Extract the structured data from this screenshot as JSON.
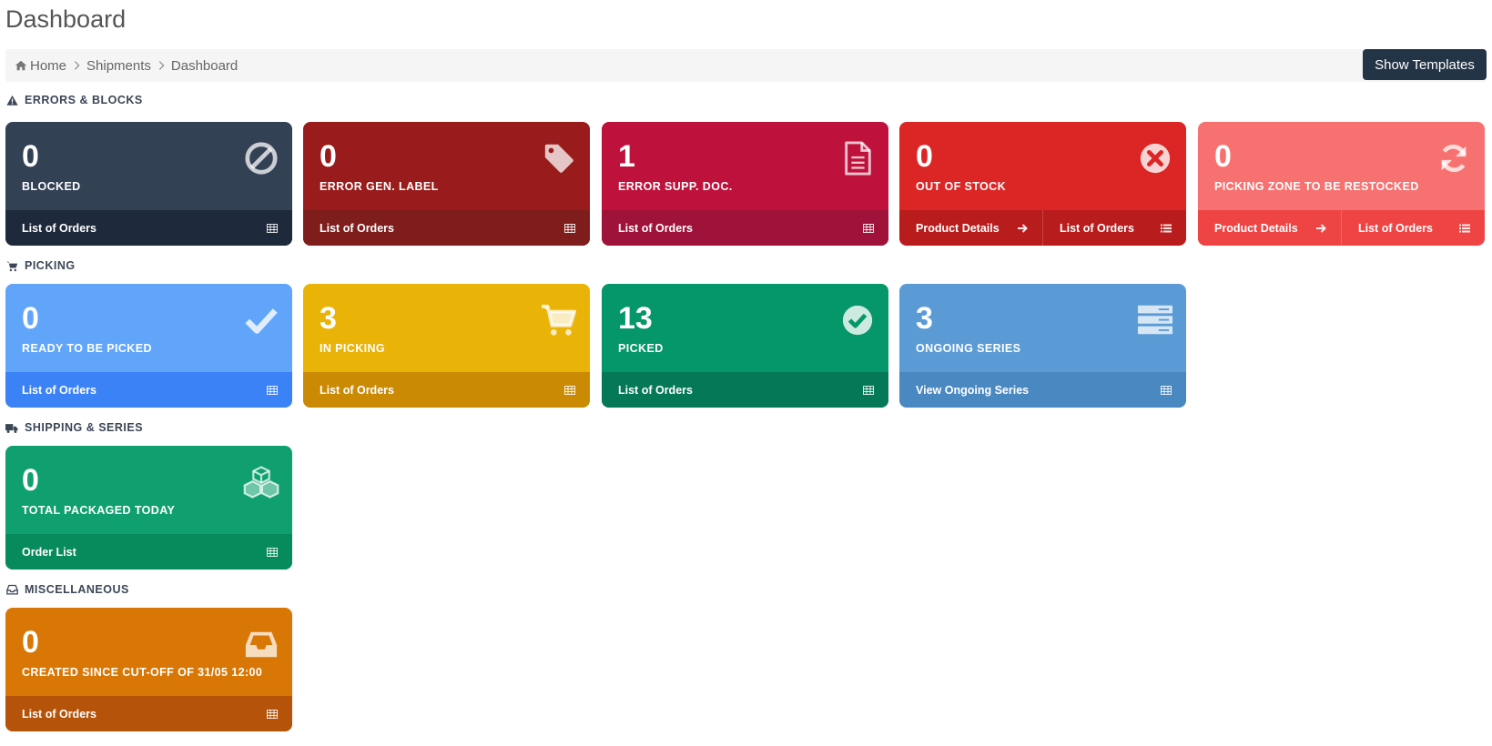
{
  "page": {
    "title": "Dashboard"
  },
  "breadcrumb": {
    "items": [
      "Home",
      "Shipments",
      "Dashboard"
    ]
  },
  "toolbar": {
    "show_templates_label": "Show Templates"
  },
  "sections": {
    "errors": {
      "title": "ERRORS & BLOCKS",
      "icon": "warning-icon"
    },
    "picking": {
      "title": "PICKING",
      "icon": "cart-icon"
    },
    "shipping": {
      "title": "SHIPPING & SERIES",
      "icon": "truck-icon"
    },
    "misc": {
      "title": "MISCELLANEOUS",
      "icon": "inbox-icon"
    }
  },
  "cards": {
    "blocked": {
      "count": "0",
      "label": "BLOCKED",
      "icon": "ban-icon",
      "bg": "#334155",
      "footer_bg": "#1e293b",
      "links": [
        "List of Orders"
      ]
    },
    "error_gen_label": {
      "count": "0",
      "label": "ERROR GEN. LABEL",
      "icon": "tag-icon",
      "bg": "#991b1b",
      "footer_bg": "#7f1d1d",
      "links": [
        "List of Orders"
      ]
    },
    "error_supp_doc": {
      "count": "1",
      "label": "ERROR SUPP. DOC.",
      "icon": "document-icon",
      "bg": "#be123c",
      "footer_bg": "#9f1239",
      "links": [
        "List of Orders"
      ]
    },
    "out_of_stock": {
      "count": "0",
      "label": "OUT OF STOCK",
      "icon": "times-circle-icon",
      "bg": "#dc2626",
      "footer_bg": "#b91c1c",
      "links": [
        "Product Details",
        "List of Orders"
      ]
    },
    "picking_zone": {
      "count": "0",
      "label": "PICKING ZONE TO BE RESTOCKED",
      "icon": "refresh-icon",
      "bg": "#f87171",
      "footer_bg": "#ef4444",
      "links": [
        "Product Details",
        "List of Orders"
      ]
    },
    "ready_to_pick": {
      "count": "0",
      "label": "READY TO BE PICKED",
      "icon": "check-icon",
      "bg": "#60a5fa",
      "footer_bg": "#3b82f6",
      "links": [
        "List of Orders"
      ]
    },
    "in_picking": {
      "count": "3",
      "label": "IN PICKING",
      "icon": "cart-icon",
      "bg": "#eab308",
      "footer_bg": "#ca8a04",
      "links": [
        "List of Orders"
      ]
    },
    "picked": {
      "count": "13",
      "label": "PICKED",
      "icon": "check-circle-icon",
      "bg": "#059669",
      "footer_bg": "#047857",
      "links": [
        "List of Orders"
      ]
    },
    "ongoing_series": {
      "count": "3",
      "label": "ONGOING SERIES",
      "icon": "server-icon",
      "bg": "#5b9bd5",
      "footer_bg": "#4a88c2",
      "links": [
        "View Ongoing Series"
      ]
    },
    "total_packaged": {
      "count": "0",
      "label": "TOTAL PACKAGED TODAY",
      "icon": "cubes-icon",
      "bg": "#10a070",
      "footer_bg": "#078a5c",
      "links": [
        "Order List"
      ]
    },
    "created_since": {
      "count": "0",
      "label": "CREATED SINCE CUT-OFF OF 31/05 12:00",
      "icon": "inbox-icon",
      "bg": "#d97706",
      "footer_bg": "#b45309",
      "links": [
        "List of Orders"
      ]
    }
  }
}
